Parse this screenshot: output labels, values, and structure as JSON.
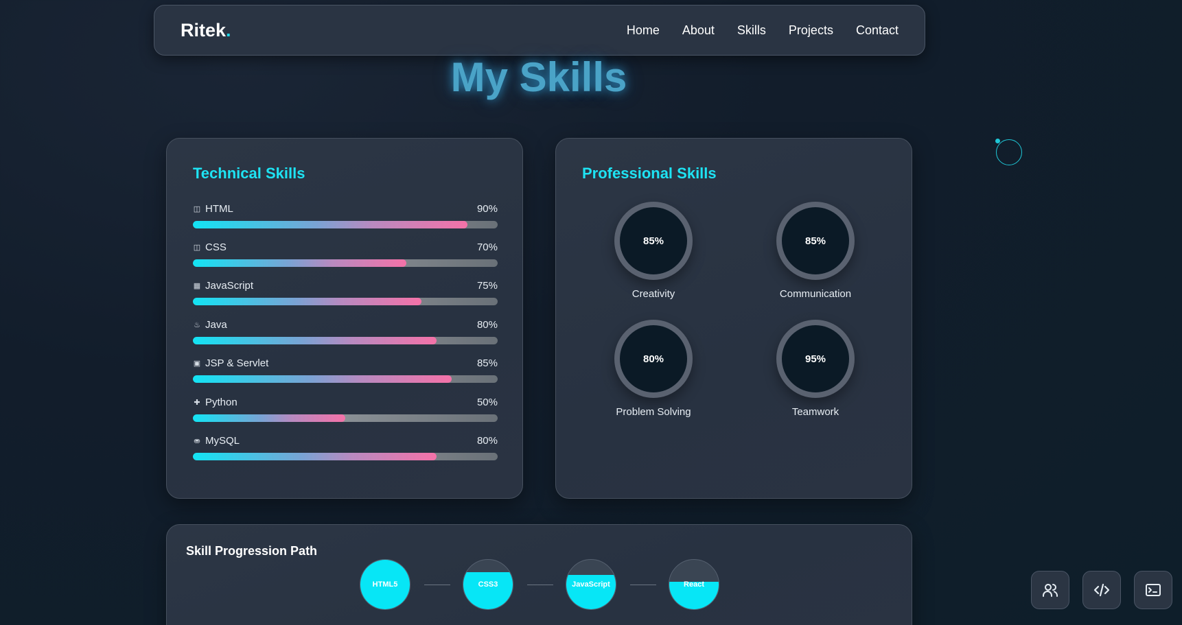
{
  "nav": {
    "logo_text": "Ritek",
    "logo_dot": ".",
    "links": [
      "Home",
      "About",
      "Skills",
      "Projects",
      "Contact"
    ]
  },
  "page_title": "My Skills",
  "technical": {
    "title": "Technical Skills",
    "skills": [
      {
        "name": "HTML",
        "pct": "90%",
        "value": 90,
        "icon": "html5-icon"
      },
      {
        "name": "CSS",
        "pct": "70%",
        "value": 70,
        "icon": "css3-icon"
      },
      {
        "name": "JavaScript",
        "pct": "75%",
        "value": 75,
        "icon": "js-icon"
      },
      {
        "name": "Java",
        "pct": "80%",
        "value": 80,
        "icon": "java-icon"
      },
      {
        "name": "JSP & Servlet",
        "pct": "85%",
        "value": 85,
        "icon": "code-window-icon"
      },
      {
        "name": "Python",
        "pct": "50%",
        "value": 50,
        "icon": "python-icon"
      },
      {
        "name": "MySQL",
        "pct": "80%",
        "value": 80,
        "icon": "database-icon"
      }
    ]
  },
  "professional": {
    "title": "Professional Skills",
    "skills": [
      {
        "name": "Creativity",
        "pct": "85%"
      },
      {
        "name": "Communication",
        "pct": "85%"
      },
      {
        "name": "Problem Solving",
        "pct": "80%"
      },
      {
        "name": "Teamwork",
        "pct": "95%"
      }
    ]
  },
  "progression": {
    "title": "Skill Progression Path",
    "nodes": [
      {
        "label": "HTML5",
        "fill": 1.0
      },
      {
        "label": "CSS3",
        "fill": 0.75
      },
      {
        "label": "JavaScript",
        "fill": 0.7
      },
      {
        "label": "React",
        "fill": 0.55
      }
    ]
  },
  "floating_buttons": [
    {
      "icon": "users-icon"
    },
    {
      "icon": "code-icon"
    },
    {
      "icon": "terminal-icon"
    }
  ],
  "colors": {
    "accent": "#1ee3f3",
    "bar_end": "#f472a8",
    "title_glow": "#4aa3c7"
  }
}
